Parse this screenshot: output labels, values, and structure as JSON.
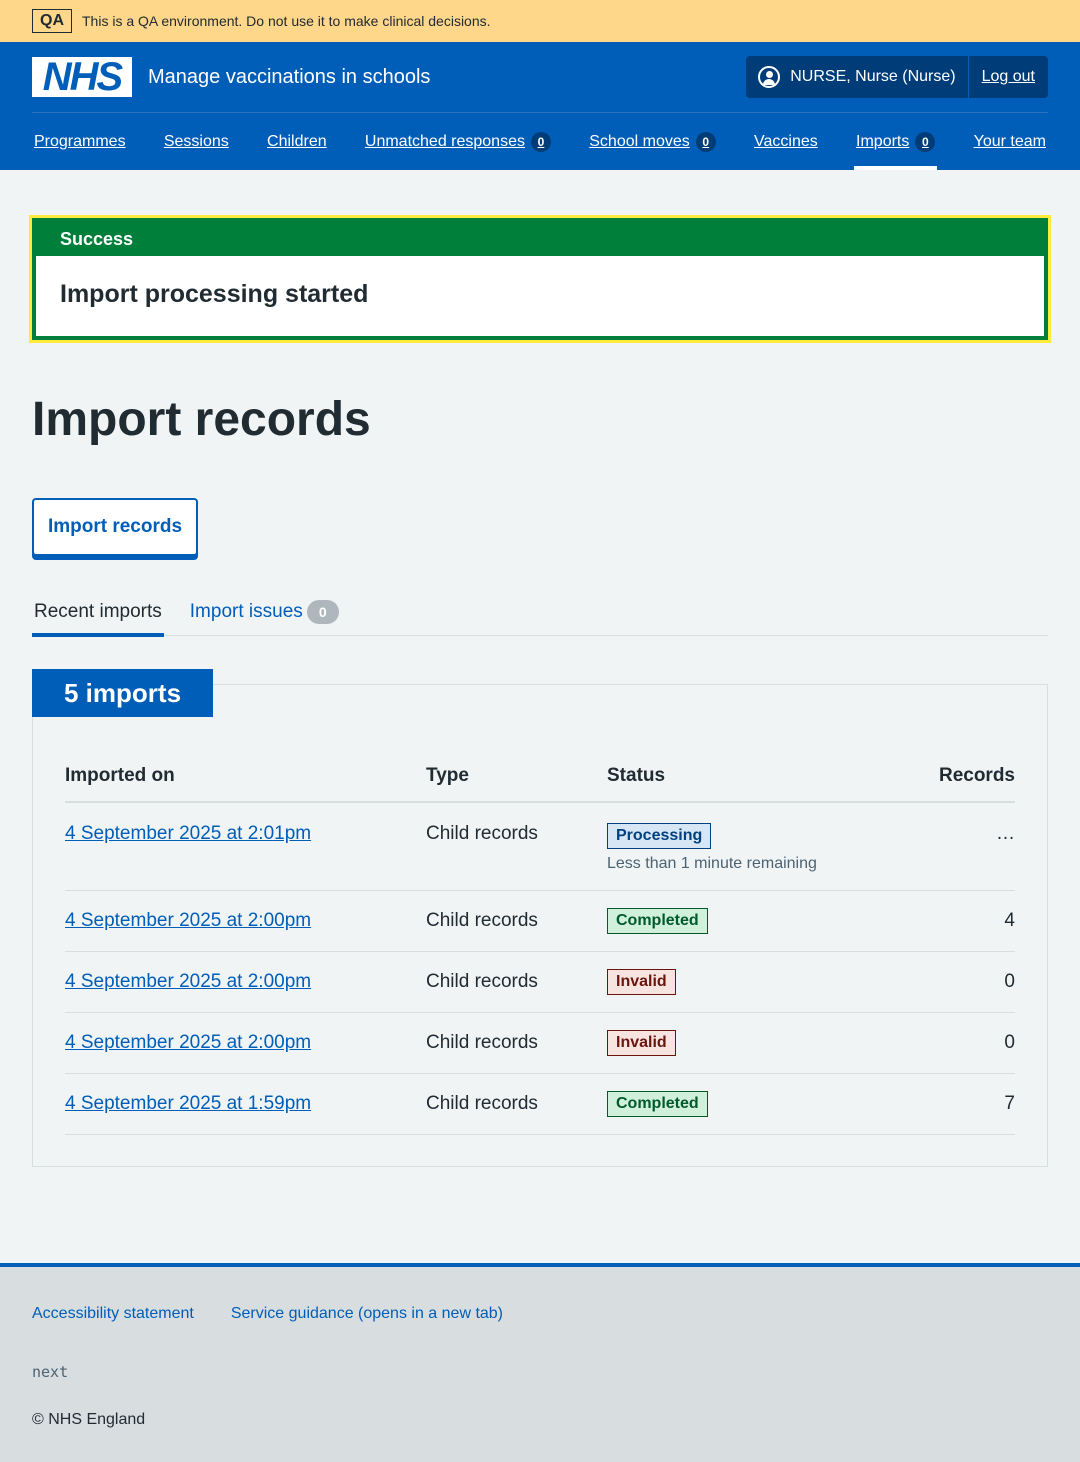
{
  "env": {
    "tag": "QA",
    "message": "This is a QA environment. Do not use it to make clinical decisions."
  },
  "header": {
    "logo": "NHS",
    "service_name": "Manage vaccinations in schools",
    "user": "NURSE, Nurse (Nurse)",
    "logout": "Log out"
  },
  "nav": {
    "programmes": "Programmes",
    "sessions": "Sessions",
    "children": "Children",
    "unmatched": "Unmatched responses",
    "unmatched_count": "0",
    "school_moves": "School moves",
    "school_moves_count": "0",
    "vaccines": "Vaccines",
    "imports": "Imports",
    "imports_count": "0",
    "your_team": "Your team"
  },
  "banner": {
    "title": "Success",
    "message": "Import processing started"
  },
  "page": {
    "title": "Import records",
    "import_button": "Import records"
  },
  "tabs": {
    "recent": "Recent imports",
    "issues": "Import issues",
    "issues_count": "0"
  },
  "imports": {
    "heading": "5 imports",
    "columns": [
      "Imported on",
      "Type",
      "Status",
      "Records"
    ],
    "rows": [
      {
        "date": "4 September 2025 at 2:01pm",
        "type": "Child records",
        "status": "Processing",
        "note": "Less than 1 minute remaining",
        "records": "…"
      },
      {
        "date": "4 September 2025 at 2:00pm",
        "type": "Child records",
        "status": "Completed",
        "records": "4"
      },
      {
        "date": "4 September 2025 at 2:00pm",
        "type": "Child records",
        "status": "Invalid",
        "records": "0"
      },
      {
        "date": "4 September 2025 at 2:00pm",
        "type": "Child records",
        "status": "Invalid",
        "records": "0"
      },
      {
        "date": "4 September 2025 at 1:59pm",
        "type": "Child records",
        "status": "Completed",
        "records": "7"
      }
    ]
  },
  "footer": {
    "accessibility": "Accessibility statement",
    "guidance": "Service guidance (opens in a new tab)",
    "version": "next",
    "copyright": "© NHS England"
  },
  "colors": {
    "nhs_blue": "#005eb8",
    "success_green": "#007f3b",
    "env_banner": "#ffd78a"
  }
}
